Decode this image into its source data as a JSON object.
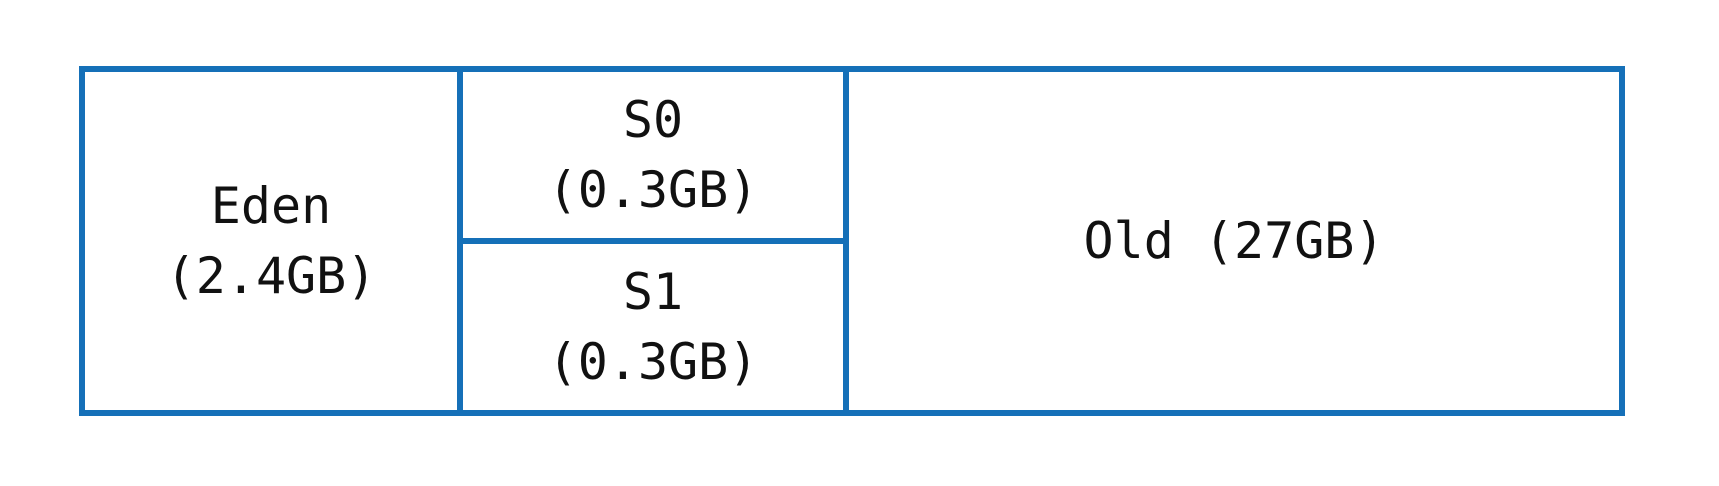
{
  "colors": {
    "border": "#1570b8",
    "text": "#111111",
    "background": "#ffffff"
  },
  "regions": {
    "eden": {
      "name": "Eden",
      "size": "(2.4GB)"
    },
    "s0": {
      "name": "S0",
      "size": "(0.3GB)"
    },
    "s1": {
      "name": "S1",
      "size": "(0.3GB)"
    },
    "old": {
      "label": "Old (27GB)"
    }
  }
}
